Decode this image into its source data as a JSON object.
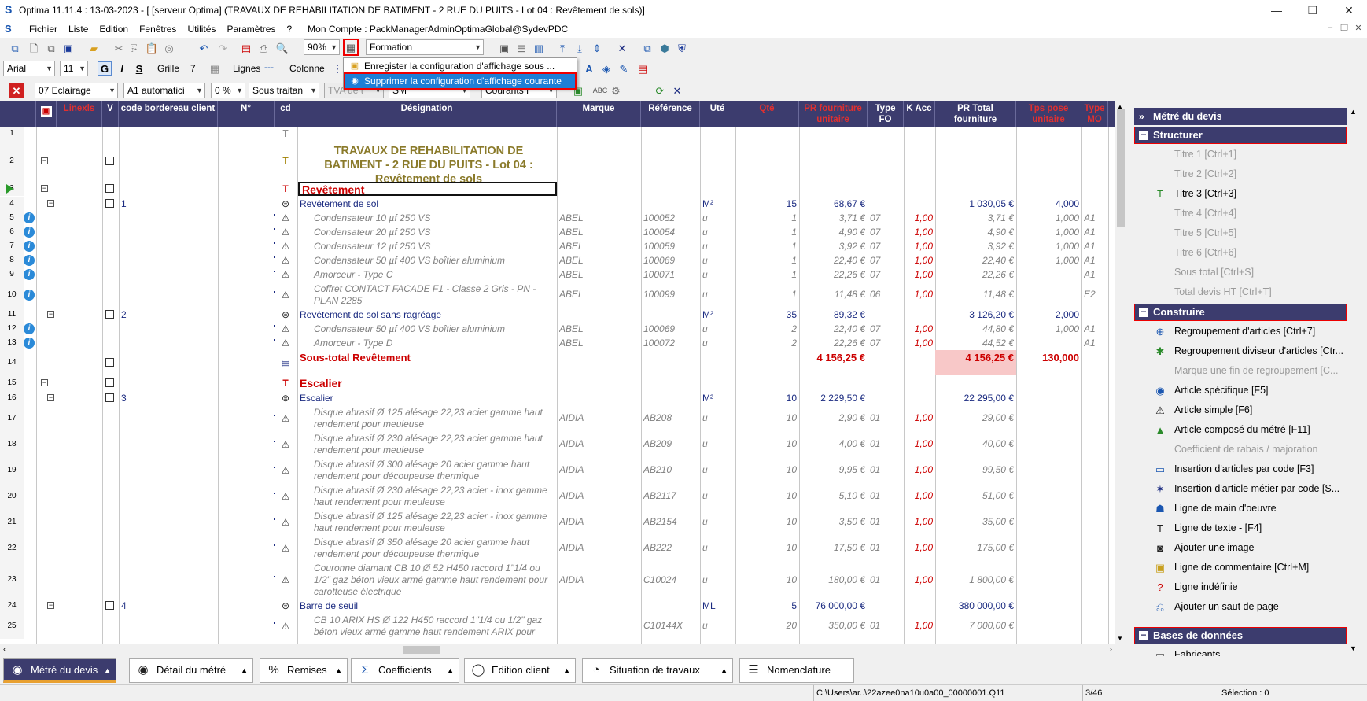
{
  "window": {
    "title": "Optima 11.11.4 : 13-03-2023 - [ [serveur Optima] (TRAVAUX DE REHABILITATION DE BATIMENT - 2 RUE DU PUITS - Lot 04 : Revêtement de sols)]",
    "minimize": "—",
    "maximize": "❐",
    "close": "✕"
  },
  "menu": {
    "items": [
      "Fichier",
      "Liste",
      "Edition",
      "Fenêtres",
      "Utilités",
      "Paramètres",
      "?",
      "Mon Compte : PackManagerAdminOptimaGlobal@SydevPDC"
    ]
  },
  "toolbar1": {
    "zoom": "90%",
    "view_select": "Formation"
  },
  "toolbar2": {
    "font": "Arial",
    "font_size": "11",
    "bold": "G",
    "italic": "I",
    "strike": "S",
    "grille_label": "Grille",
    "grille_value": "7",
    "lignes_label": "Lignes",
    "colonne_label": "Colonne"
  },
  "toolbar3": {
    "lot": "07  Eclairage",
    "code": "A1  automatici",
    "pct": "0 %",
    "sous_traitance": "Sous traitan",
    "tva": "TVA de t",
    "sm": "SM",
    "courants": "Courants f"
  },
  "dropdown_menu": {
    "item1": "Enregister la configuration d'affichage sous ...",
    "item2": "Supprimer la configuration d'affichage courante"
  },
  "grid": {
    "headers": {
      "linexls": "Linexls",
      "v": "V",
      "code_bordereau": "code bordereau client",
      "num": "N°",
      "cd": "cd",
      "designation": "Désignation",
      "marque": "Marque",
      "reference": "Référence",
      "ute": "Uté",
      "qte": "Qté",
      "pr_fourniture": "PR fourniture unitaire",
      "type_fo": "Type FO",
      "k_acc": "K Acc",
      "pr_total": "PR Total fourniture",
      "tps_pose": "Tps pose unitaire",
      "type_mo": "Type MO"
    },
    "title_text": "TRAVAUX DE REHABILITATION DE BATIMENT - 2 RUE DU PUITS  - Lot 04 : Revêtement de sols",
    "rows": [
      {
        "n": "4",
        "num": "1",
        "des": "Revêtement de sol",
        "kind": "art",
        "ute": "M²",
        "qte": "15",
        "pu": "68,67 €",
        "tot": "1 030,05 €",
        "tps": "4,000"
      },
      {
        "n": "5",
        "des": "Condensateur 10 µf 250 VS",
        "kind": "sub",
        "marque": "ABEL",
        "ref": "100052",
        "ute": "u",
        "qte": "1",
        "pu": "3,71 €",
        "tfo": "07",
        "k": "1,00",
        "tot": "3,71 €",
        "tps": "1,000",
        "tmo": "A1"
      },
      {
        "n": "6",
        "des": "Condensateur 20 µf 250 VS",
        "kind": "sub",
        "marque": "ABEL",
        "ref": "100054",
        "ute": "u",
        "qte": "1",
        "pu": "4,90 €",
        "tfo": "07",
        "k": "1,00",
        "tot": "4,90 €",
        "tps": "1,000",
        "tmo": "A1"
      },
      {
        "n": "7",
        "des": "Condensateur 12 µf 250 VS",
        "kind": "sub",
        "marque": "ABEL",
        "ref": "100059",
        "ute": "u",
        "qte": "1",
        "pu": "3,92 €",
        "tfo": "07",
        "k": "1,00",
        "tot": "3,92 €",
        "tps": "1,000",
        "tmo": "A1"
      },
      {
        "n": "8",
        "des": "Condensateur 50 µf 400 VS boîtier aluminium",
        "kind": "sub",
        "marque": "ABEL",
        "ref": "100069",
        "ute": "u",
        "qte": "1",
        "pu": "22,40 €",
        "tfo": "07",
        "k": "1,00",
        "tot": "22,40 €",
        "tps": "1,000",
        "tmo": "A1"
      },
      {
        "n": "9",
        "des": "Amorceur  - Type C",
        "kind": "sub",
        "marque": "ABEL",
        "ref": "100071",
        "ute": "u",
        "qte": "1",
        "pu": "22,26 €",
        "tfo": "07",
        "k": "1,00",
        "tot": "22,26 €",
        "tps": "",
        "tmo": "A1"
      },
      {
        "n": "10",
        "des": "Coffret CONTACT FACADE F1 - Classe 2 Gris - PN - PLAN 2285",
        "kind": "sub2",
        "marque": "ABEL",
        "ref": "100099",
        "ute": "u",
        "qte": "1",
        "pu": "11,48 €",
        "tfo": "06",
        "k": "1,00",
        "tot": "11,48 €",
        "tps": "",
        "tmo": "E2"
      },
      {
        "n": "11",
        "num": "2",
        "des": "Revêtement de sol sans ragréage",
        "kind": "art",
        "ute": "M²",
        "qte": "35",
        "pu": "89,32 €",
        "tot": "3 126,20 €",
        "tps": "2,000"
      },
      {
        "n": "12",
        "des": "Condensateur 50 µf 400 VS boîtier aluminium",
        "kind": "sub",
        "marque": "ABEL",
        "ref": "100069",
        "ute": "u",
        "qte": "2",
        "pu": "22,40 €",
        "tfo": "07",
        "k": "1,00",
        "tot": "44,80 €",
        "tps": "1,000",
        "tmo": "A1"
      },
      {
        "n": "13",
        "des": "Amorceur  - Type D",
        "kind": "sub",
        "marque": "ABEL",
        "ref": "100072",
        "ute": "u",
        "qte": "2",
        "pu": "22,26 €",
        "tfo": "07",
        "k": "1,00",
        "tot": "44,52 €",
        "tps": "",
        "tmo": "A1"
      },
      {
        "n": "14",
        "des": "Sous-total Revêtement",
        "kind": "subtotal",
        "pu": "4 156,25 €",
        "tot": "4 156,25 €",
        "tps": "130,000"
      },
      {
        "n": "15",
        "des": "Escalier",
        "kind": "section"
      },
      {
        "n": "16",
        "num": "3",
        "des": "Escalier",
        "kind": "art",
        "ute": "M²",
        "qte": "10",
        "pu": "2 229,50 €",
        "tot": "22 295,00 €"
      },
      {
        "n": "17",
        "des": "Disque abrasif Ø 125 alésage 22,23 acier gamme haut rendement pour meuleuse",
        "kind": "sub2",
        "marque": "AIDIA",
        "ref": "AB208",
        "ute": "u",
        "qte": "10",
        "pu": "2,90 €",
        "tfo": "01",
        "k": "1,00",
        "tot": "29,00 €"
      },
      {
        "n": "18",
        "des": "Disque abrasif Ø 230 alésage 22,23 acier gamme haut rendement pour meuleuse",
        "kind": "sub2",
        "marque": "AIDIA",
        "ref": "AB209",
        "ute": "u",
        "qte": "10",
        "pu": "4,00 €",
        "tfo": "01",
        "k": "1,00",
        "tot": "40,00 €"
      },
      {
        "n": "19",
        "des": "Disque abrasif Ø 300 alésage 20 acier gamme haut rendement pour découpeuse thermique",
        "kind": "sub2",
        "marque": "AIDIA",
        "ref": "AB210",
        "ute": "u",
        "qte": "10",
        "pu": "9,95 €",
        "tfo": "01",
        "k": "1,00",
        "tot": "99,50 €"
      },
      {
        "n": "20",
        "des": "Disque abrasif Ø 230 alésage 22,23 acier - inox gamme haut rendement pour meuleuse",
        "kind": "sub2",
        "marque": "AIDIA",
        "ref": "AB2117",
        "ute": "u",
        "qte": "10",
        "pu": "5,10 €",
        "tfo": "01",
        "k": "1,00",
        "tot": "51,00 €"
      },
      {
        "n": "21",
        "des": "Disque abrasif Ø 125 alésage 22,23 acier - inox gamme haut rendement pour meuleuse",
        "kind": "sub2",
        "marque": "AIDIA",
        "ref": "AB2154",
        "ute": "u",
        "qte": "10",
        "pu": "3,50 €",
        "tfo": "01",
        "k": "1,00",
        "tot": "35,00 €"
      },
      {
        "n": "22",
        "des": "Disque abrasif Ø 350 alésage 20 acier gamme haut rendement pour découpeuse thermique",
        "kind": "sub2",
        "marque": "AIDIA",
        "ref": "AB222",
        "ute": "u",
        "qte": "10",
        "pu": "17,50 €",
        "tfo": "01",
        "k": "1,00",
        "tot": "175,00 €"
      },
      {
        "n": "23",
        "des": "Couronne diamant CB 10 Ø 52 H450 raccord 1\"1/4 ou 1/2\" gaz béton vieux armé gamme haut rendement pour carotteuse électrique",
        "kind": "sub3",
        "marque": "AIDIA",
        "ref": "C10024",
        "ute": "u",
        "qte": "10",
        "pu": "180,00 €",
        "tfo": "01",
        "k": "1,00",
        "tot": "1 800,00 €"
      },
      {
        "n": "24",
        "num": "4",
        "des": "Barre de seuil",
        "kind": "art",
        "ute": "ML",
        "qte": "5",
        "pu": "76 000,00 €",
        "tot": "380 000,00 €"
      },
      {
        "n": "25",
        "des": "CB 10 ARIX HS Ø 122 H450 raccord 1\"1/4 ou 1/2\" gaz béton vieux armé gamme haut rendement ARIX pour",
        "kind": "sub2",
        "marque": "",
        "ref": "C10144X",
        "ute": "u",
        "qte": "20",
        "pu": "350,00 €",
        "tfo": "01",
        "k": "1,00",
        "tot": "7 000,00 €"
      }
    ],
    "row1": "1",
    "row2": "2",
    "row3": "3",
    "section1": "Revêtement"
  },
  "panel": {
    "header1": "Métré du devis",
    "structurer": "Structurer",
    "structurer_items": [
      "Titre 1 [Ctrl+1]",
      "Titre 2 [Ctrl+2]",
      "Titre 3 [Ctrl+3]",
      "Titre 4 [Ctrl+4]",
      "Titre 5 [Ctrl+5]",
      "Titre 6 [Ctrl+6]",
      "Sous total [Ctrl+S]",
      "Total devis HT [Ctrl+T]"
    ],
    "construire": "Construire",
    "construire_items": [
      "Regroupement d'articles  [Ctrl+7]",
      "Regroupement diviseur d'articles [Ctr...",
      "Marque une fin de regroupement   [C...",
      "Article spécifique [F5]",
      "Article simple [F6]",
      "Article composé du métré [F11]",
      "Coefficient de rabais / majoration",
      "Insertion d'articles par code [F3]",
      "Insertion d'article métier par code [S...",
      "Ligne de main d'oeuvre",
      "Ligne de texte - [F4]",
      "Ajouter une image",
      "Ligne de commentaire [Ctrl+M]",
      "Ligne indéfinie",
      "Ajouter un saut de page"
    ],
    "bases": "Bases de données",
    "bases_items": [
      "Fabricants"
    ]
  },
  "bottom_tabs": [
    "Métré du devis",
    "Détail du métré",
    "Remises",
    "Coefficients",
    "Edition client",
    "Situation de travaux",
    "Nomenclature"
  ],
  "status": {
    "path": "C:\\Users\\ar..\\22azee0na10u0a00_00000001.Q11",
    "page": "3/46",
    "selection": "Sélection : 0"
  }
}
